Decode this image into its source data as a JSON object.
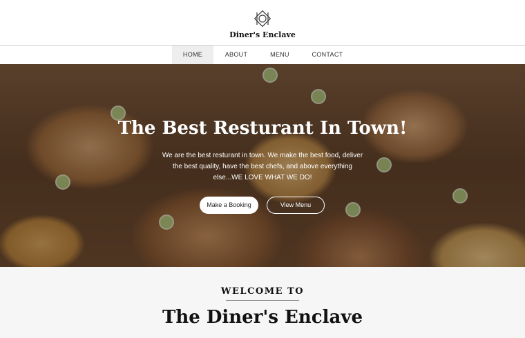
{
  "brand": {
    "name": "Diner's Enclave",
    "logo_icon": "plate-fork-knife-icon"
  },
  "nav": {
    "items": [
      "HOME",
      "ABOUT",
      "MENU",
      "CONTACT"
    ],
    "active": "HOME"
  },
  "hero": {
    "title": "The Best Resturant In Town!",
    "copy": "We are the best resturant in town. We make the best food, deliver the best quality, have the best chefs, and above everything else...WE LOVE WHAT WE DO!",
    "primary_button": "Make a Booking",
    "secondary_button": "View Menu"
  },
  "welcome": {
    "kicker": "WELCOME TO",
    "title": "The Diner's Enclave"
  }
}
